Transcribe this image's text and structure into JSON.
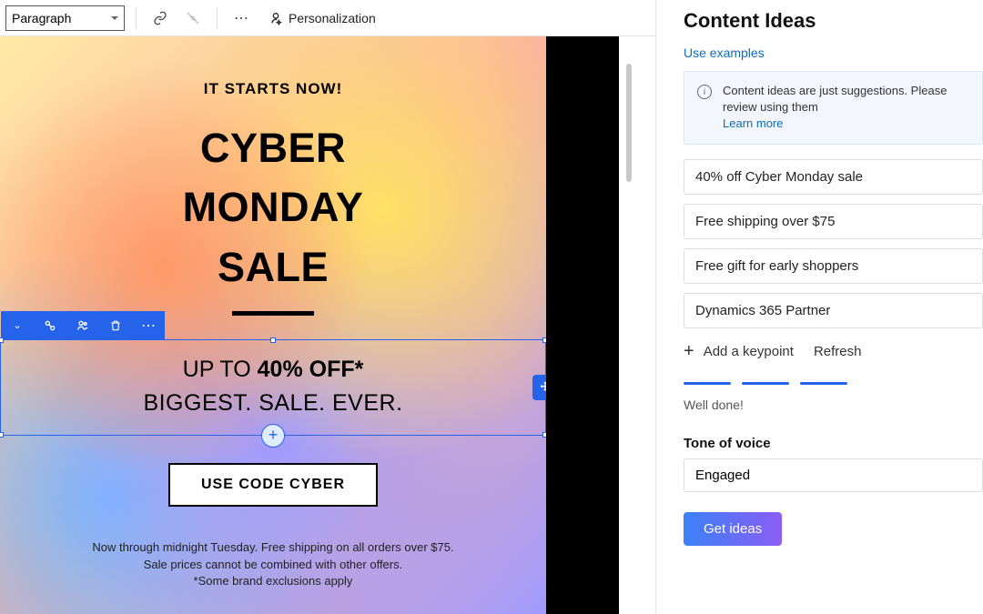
{
  "toolbar": {
    "style_value": "Paragraph",
    "personalization_label": "Personalization"
  },
  "email": {
    "preheader": "IT STARTS NOW!",
    "hero_line1": "CYBER",
    "hero_line2": "MONDAY",
    "hero_line3": "SALE",
    "discount_prefix": "UP TO ",
    "discount_strong": "40% OFF*",
    "biggest": "BIGGEST. SALE. EVER.",
    "cta": "USE CODE CYBER",
    "fine1": "Now through midnight Tuesday. Free shipping on all orders over $75.",
    "fine2": "Sale prices cannot be combined with other offers.",
    "fine3": "*Some brand exclusions apply"
  },
  "panel": {
    "title": "Content Ideas",
    "use_examples": "Use examples",
    "info_text": "Content ideas are just suggestions. Please review using them",
    "learn_more": "Learn more",
    "keypoints": [
      "40% off Cyber Monday sale",
      "Free shipping over $75",
      "Free gift for early shoppers",
      "Dynamics 365 Partner"
    ],
    "add_keypoint": "Add a keypoint",
    "refresh": "Refresh",
    "done": "Well done!",
    "tone_label": "Tone of voice",
    "tone_value": "Engaged",
    "get_ideas": "Get ideas"
  }
}
